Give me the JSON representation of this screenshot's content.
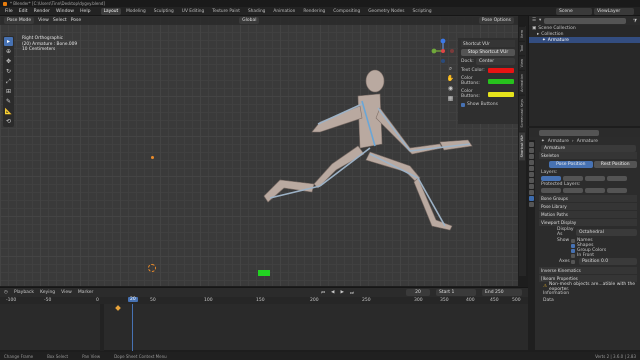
{
  "window": {
    "title": "* Blender* [C:\\Users\\Tinn\\Desktop\\dygvy.blend]"
  },
  "menu": [
    "File",
    "Edit",
    "Render",
    "Window",
    "Help"
  ],
  "workspaces": [
    "Layout",
    "Modeling",
    "Sculpting",
    "UV Editing",
    "Texture Paint",
    "Shading",
    "Animation",
    "Rendering",
    "Compositing",
    "Geometry Nodes",
    "Scripting"
  ],
  "scene": {
    "label": "Scene",
    "view_layer": "ViewLayer"
  },
  "viewport": {
    "mode": "Pose Mode",
    "menus": [
      "View",
      "Select",
      "Pose"
    ],
    "orientation": "Global",
    "info_line1": "Right Orthographic",
    "info_line2": "(20) Armature : Bone.009",
    "info_line3": "10 Centimeters",
    "pose_options": "Pose Options"
  },
  "shortcut_panel": {
    "header": "Shortcut VUr",
    "stop_button": "Stop Shortcut VUr",
    "dock_label": "Dock:",
    "dock_value": "Center",
    "text_color_label": "Text Color:",
    "color_buttons_label": "Color Buttons:",
    "color_buttons2_label": "Color Buttons:",
    "show_buttons": "Show Buttons",
    "text_color": "#e81313",
    "buttons_color": "#27c21d",
    "buttons2_color": "#e6e31c"
  },
  "n_tabs": [
    "Item",
    "Tool",
    "View",
    "Animation",
    "Screencast Keys",
    "Shortcut VUr"
  ],
  "outliner": {
    "root": "Scene Collection",
    "collection": "Collection",
    "item": "Armature"
  },
  "properties": {
    "breadcrumb_a": "Armature",
    "breadcrumb_b": "Armature",
    "name": "Armature",
    "skeleton": "Skeleton",
    "pose_position": "Pose Position",
    "rest_position": "Rest Position",
    "layers": "Layers:",
    "protected_layers": "Protected Layers:",
    "bone_groups": "Bone Groups",
    "pose_library": "Pose Library",
    "motion_paths": "Motion Paths",
    "viewport_display": "Viewport Display",
    "display_as_label": "Display As",
    "display_as_value": "Octahedral",
    "show_label": "Show",
    "names": "Names",
    "shapes": "Shapes",
    "group_colors": "Group Colors",
    "in_front": "In Front",
    "axes": "Axes",
    "position_label": "Position",
    "position_value": "0.0",
    "inverse_kinematics": "Inverse Kinematics",
    "ikea": "[Ikeam Properties",
    "warning": "Non-mesh objects are...atible with the exporter.",
    "information": "Information",
    "data": "Data"
  },
  "timeline": {
    "menus": [
      "Playback",
      "Keying",
      "View",
      "Marker"
    ],
    "current_frame": "20",
    "start_label": "Start",
    "start_value": "1",
    "end_label": "End",
    "end_value": "250",
    "ruler": [
      "-100",
      "-50",
      "0",
      "20",
      "50",
      "100",
      "150",
      "200",
      "250",
      "300",
      "350",
      "400",
      "450",
      "500"
    ]
  },
  "status": {
    "select": "Change Frame",
    "box": "Box Select",
    "pan": "Pan View",
    "menu": "Dope Sheet Context Menu",
    "version": "Verts 2 | 3.6.0 | 2.83"
  }
}
